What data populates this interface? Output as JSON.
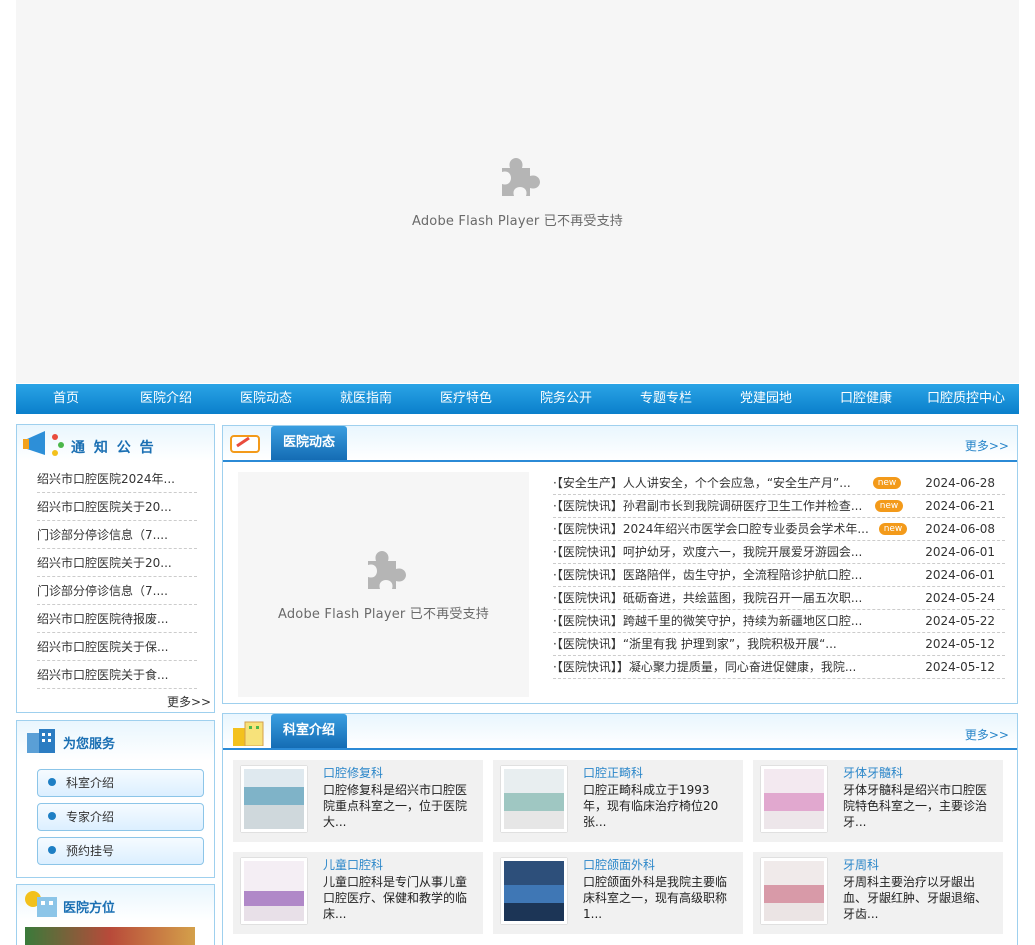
{
  "flash_message": "Adobe Flash Player 已不再受支持",
  "nav": [
    "首页",
    "医院介绍",
    "医院动态",
    "就医指南",
    "医疗特色",
    "院务公开",
    "专题专栏",
    "党建园地",
    "口腔健康",
    "口腔质控中心"
  ],
  "notice": {
    "title": "通 知 公 告",
    "items": [
      "绍兴市口腔医院2024年...",
      "绍兴市口腔医院关于20...",
      "门诊部分停诊信息（7....",
      "绍兴市口腔医院关于20...",
      "门诊部分停诊信息（7....",
      "绍兴市口腔医院待报废...",
      "绍兴市口腔医院关于保...",
      "绍兴市口腔医院关于食..."
    ],
    "more": "更多>>"
  },
  "service": {
    "title": "为您服务",
    "buttons": [
      "科室介绍",
      "专家介绍",
      "预约挂号"
    ]
  },
  "location": {
    "title": "医院方位"
  },
  "news": {
    "title": "医院动态",
    "more": "更多>>",
    "items": [
      {
        "text": "·【安全生产】人人讲安全，个个会应急，“安全生产月”...",
        "new": "new",
        "date": "2024-06-28"
      },
      {
        "text": "·【医院快讯】孙君副市长到我院调研医疗卫生工作并检查...",
        "new": "new",
        "date": "2024-06-21"
      },
      {
        "text": "·【医院快讯】2024年绍兴市医学会口腔专业委员会学术年...",
        "new": "new",
        "date": "2024-06-08"
      },
      {
        "text": "·【医院快讯】呵护幼牙，欢度六一，我院开展爱牙游园会...",
        "new": "",
        "date": "2024-06-01"
      },
      {
        "text": "·【医院快讯】医路陪伴，齿生守护，全流程陪诊护航口腔...",
        "new": "",
        "date": "2024-06-01"
      },
      {
        "text": "·【医院快讯】砥砺奋进，共绘蓝图，我院召开一届五次职...",
        "new": "",
        "date": "2024-05-24"
      },
      {
        "text": "·【医院快讯】跨越千里的微笑守护，持续为新疆地区口腔...",
        "new": "",
        "date": "2024-05-22"
      },
      {
        "text": "·【医院快讯】“浙里有我 护理到家”，我院积极开展“...",
        "new": "",
        "date": "2024-05-12"
      },
      {
        "text": "·【医院快讯】】凝心聚力提质量，同心奋进促健康，我院...",
        "new": "",
        "date": "2024-05-12"
      }
    ]
  },
  "depts": {
    "title": "科室介绍",
    "more": "更多>>",
    "items": [
      {
        "name": "口腔修复科",
        "desc": "口腔修复科是绍兴市口腔医院重点科室之一，位于医院大..."
      },
      {
        "name": "口腔正畸科",
        "desc": "口腔正畸科成立于1993年，现有临床治疗椅位20张..."
      },
      {
        "name": "牙体牙髓科",
        "desc": "牙体牙髓科是绍兴市口腔医院特色科室之一，主要诊治牙..."
      },
      {
        "name": "儿童口腔科",
        "desc": "儿童口腔科是专门从事儿童口腔医疗、保健和教学的临床..."
      },
      {
        "name": "口腔颌面外科",
        "desc": "口腔颌面外科是我院主要临床科室之一，现有高级职称1..."
      },
      {
        "name": "牙周科",
        "desc": "牙周科主要治疗以牙龈出血、牙龈红肿、牙龈退缩、牙齿..."
      }
    ]
  }
}
